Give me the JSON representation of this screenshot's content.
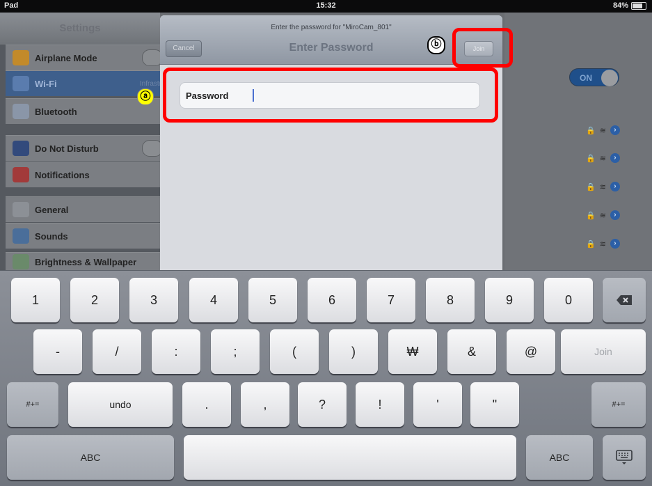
{
  "status_bar": {
    "carrier": "Pad",
    "time": "15:32",
    "battery": "84%"
  },
  "settings": {
    "title": "Settings",
    "items": [
      {
        "label": "Airplane Mode"
      },
      {
        "label": "Wi-Fi",
        "value": "Infrastr"
      },
      {
        "label": "Bluetooth"
      },
      {
        "label": "Do Not Disturb"
      },
      {
        "label": "Notifications"
      },
      {
        "label": "General"
      },
      {
        "label": "Sounds"
      },
      {
        "label": "Brightness & Wallpaper"
      }
    ],
    "wifi_switch": "ON"
  },
  "dialog": {
    "subtitle": "Enter the password for \"MiroCam_801\"",
    "title": "Enter Password",
    "cancel": "Cancel",
    "join": "Join",
    "password_label": "Password",
    "password_value": ""
  },
  "annotations": {
    "a": "ⓐ",
    "b": "ⓑ"
  },
  "keyboard": {
    "row1": [
      "1",
      "2",
      "3",
      "4",
      "5",
      "6",
      "7",
      "8",
      "9",
      "0"
    ],
    "row2": [
      "-",
      "/",
      ":",
      ";",
      "(",
      ")",
      "₩",
      "&",
      "@"
    ],
    "join": "Join",
    "row3_left": "#+=",
    "undo": "undo",
    "row3": [
      ".",
      ",",
      "?",
      "!",
      "'",
      "\""
    ],
    "row3_right": "#+=",
    "abc_left": "ABC",
    "abc_right": "ABC"
  },
  "colors": {
    "annotation_red": "#ff0000",
    "badge_yellow": "#ffff00"
  }
}
